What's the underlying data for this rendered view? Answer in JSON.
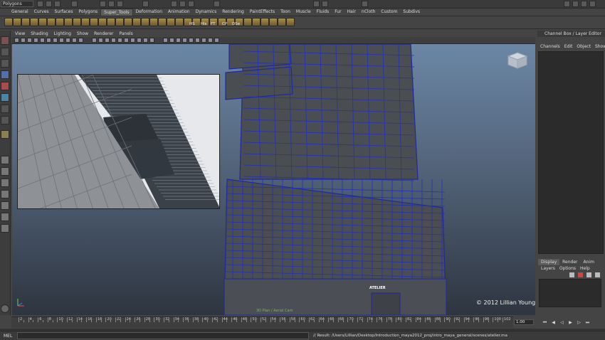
{
  "statusline": {
    "mode": "Polygons"
  },
  "shelf": {
    "tabs": [
      "General",
      "Curves",
      "Surfaces",
      "Polygons",
      "Super_Tools",
      "Deformation",
      "Animation",
      "Dynamics",
      "Rendering",
      "PaintEffects",
      "Toon",
      "Muscle",
      "Fluids",
      "Fur",
      "Hair",
      "nCloth",
      "Custom",
      "Subdivs"
    ],
    "active_tab": "Super_Tools",
    "labels": [
      "HS",
      "His",
      "FT",
      "CP",
      "DSe"
    ]
  },
  "panel": {
    "menu": [
      "View",
      "Shading",
      "Lighting",
      "Show",
      "Renderer",
      "Panels"
    ]
  },
  "viewport": {
    "copyright": "© 2012 Lillian Young",
    "caption": "3D Plan / Aerial Cam",
    "sign_text": "ATELIER"
  },
  "channel_box": {
    "title": "Channel Box / Layer Editor",
    "menu": [
      "Channels",
      "Edit",
      "Object",
      "Show"
    ]
  },
  "layer_editor": {
    "tabs": [
      "Display",
      "Render",
      "Anim"
    ],
    "active_tab": "Display",
    "menu": [
      "Layers",
      "Options",
      "Help"
    ]
  },
  "timeslider": {
    "ticks": [
      "2",
      "4",
      "6",
      "8",
      "10",
      "12",
      "14",
      "16",
      "18",
      "20",
      "22",
      "24",
      "26",
      "28",
      "30",
      "32",
      "34",
      "36",
      "38",
      "40",
      "42",
      "44",
      "46",
      "48",
      "50",
      "52",
      "54",
      "56",
      "58",
      "60",
      "62",
      "64",
      "66",
      "68",
      "70",
      "72",
      "74",
      "76",
      "78",
      "80",
      "82",
      "84",
      "86",
      "88",
      "90",
      "92",
      "94",
      "96",
      "98",
      "100",
      "102"
    ],
    "current_frame": "1.00"
  },
  "commandline": {
    "label": "MEL",
    "result": "// Result: /Users/Lillian/Desktop/Introduction_maya2012_proj/intro_maya_general/scenes/atelier.ma"
  },
  "colors": {
    "accent_tab": "#5d5d5d",
    "viewport_top": "#6b87a6",
    "viewport_bottom": "#2e3540",
    "wire": "#1e2a9c"
  }
}
